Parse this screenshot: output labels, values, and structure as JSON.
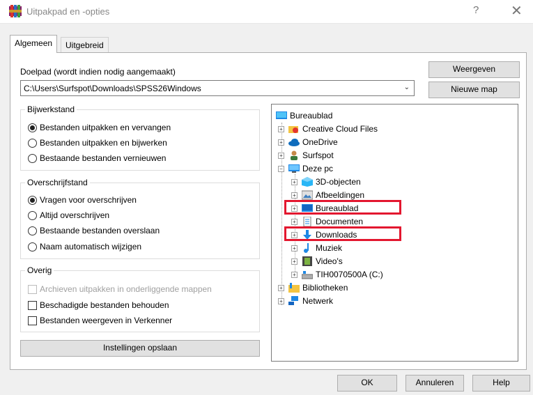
{
  "window": {
    "title": "Uitpakpad en -opties",
    "help_glyph": "?",
    "close_glyph": "✕"
  },
  "tabs": [
    "Algemeen",
    "Uitgebreid"
  ],
  "destination": {
    "label": "Doelpad (wordt indien nodig aangemaakt)",
    "value": "C:\\Users\\Surfspot\\Downloads\\SPSS26Windows"
  },
  "buttons": {
    "show": "Weergeven",
    "new_folder": "Nieuwe map",
    "save_settings": "Instellingen opslaan",
    "ok": "OK",
    "cancel": "Annuleren",
    "help": "Help"
  },
  "update_mode": {
    "title": "Bijwerkstand",
    "options": [
      {
        "label": "Bestanden uitpakken en vervangen",
        "checked": true
      },
      {
        "label": "Bestanden uitpakken en bijwerken",
        "checked": false
      },
      {
        "label": "Bestaande bestanden vernieuwen",
        "checked": false
      }
    ]
  },
  "overwrite_mode": {
    "title": "Overschrijfstand",
    "options": [
      {
        "label": "Vragen voor overschrijven",
        "checked": true
      },
      {
        "label": "Altijd overschrijven",
        "checked": false
      },
      {
        "label": "Bestaande bestanden overslaan",
        "checked": false
      },
      {
        "label": "Naam automatisch wijzigen",
        "checked": false
      }
    ]
  },
  "misc": {
    "title": "Overig",
    "options": [
      {
        "label": "Archieven uitpakken in onderliggende mappen",
        "checked": false,
        "disabled": true
      },
      {
        "label": "Beschadigde bestanden behouden",
        "checked": false,
        "disabled": false
      },
      {
        "label": "Bestanden weergeven in Verkenner",
        "checked": false,
        "disabled": false
      }
    ]
  },
  "tree": {
    "root": "Bureaublad",
    "items": [
      {
        "label": "Creative Cloud Files",
        "icon": "creative-cloud-icon"
      },
      {
        "label": "OneDrive",
        "icon": "onedrive-icon"
      },
      {
        "label": "Surfspot",
        "icon": "user-icon"
      },
      {
        "label": "Deze pc",
        "icon": "computer-icon"
      },
      {
        "label": "3D-objecten",
        "icon": "3d-objects-icon"
      },
      {
        "label": "Afbeeldingen",
        "icon": "pictures-icon"
      },
      {
        "label": "Bureaublad",
        "icon": "desktop-icon"
      },
      {
        "label": "Documenten",
        "icon": "documents-icon"
      },
      {
        "label": "Downloads",
        "icon": "downloads-icon"
      },
      {
        "label": "Muziek",
        "icon": "music-icon"
      },
      {
        "label": "Video's",
        "icon": "videos-icon"
      },
      {
        "label": "TIH0070500A (C:)",
        "icon": "drive-icon"
      },
      {
        "label": "Bibliotheken",
        "icon": "libraries-icon"
      },
      {
        "label": "Netwerk",
        "icon": "network-icon"
      }
    ]
  },
  "colors": {
    "highlight": "#e3172f",
    "folder_blue": "#1e88e5"
  }
}
